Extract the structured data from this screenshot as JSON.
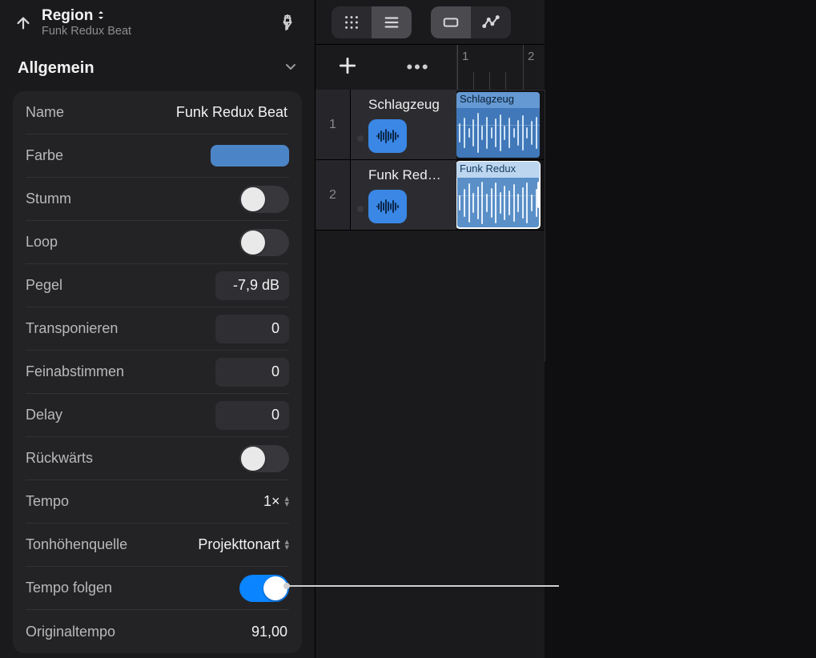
{
  "header": {
    "title": "Region",
    "subtitle": "Funk Redux Beat"
  },
  "section": {
    "title": "Allgemein"
  },
  "props": {
    "name_label": "Name",
    "name_value": "Funk Redux Beat",
    "color_label": "Farbe",
    "color_hex": "#4c85c7",
    "mute_label": "Stumm",
    "mute_on": false,
    "loop_label": "Loop",
    "loop_on": false,
    "level_label": "Pegel",
    "level_value": "-7,9 dB",
    "transpose_label": "Transponieren",
    "transpose_value": "0",
    "finetune_label": "Feinabstimmen",
    "finetune_value": "0",
    "delay_label": "Delay",
    "delay_value": "0",
    "reverse_label": "Rückwärts",
    "reverse_on": false,
    "tempo_label": "Tempo",
    "tempo_value": "1×",
    "pitchsrc_label": "Tonhöhenquelle",
    "pitchsrc_value": "Projekttonart",
    "followtempo_label": "Tempo folgen",
    "followtempo_on": true,
    "origtempo_label": "Originaltempo",
    "origtempo_value": "91,00"
  },
  "ruler": {
    "marks": [
      "1",
      "2"
    ]
  },
  "tracks": [
    {
      "num": "1",
      "name": "Schlagzeug",
      "clip_label": "Schlagzeug",
      "selected": false
    },
    {
      "num": "2",
      "name": "Funk Red…",
      "clip_label": "Funk Redux",
      "selected": true
    }
  ]
}
